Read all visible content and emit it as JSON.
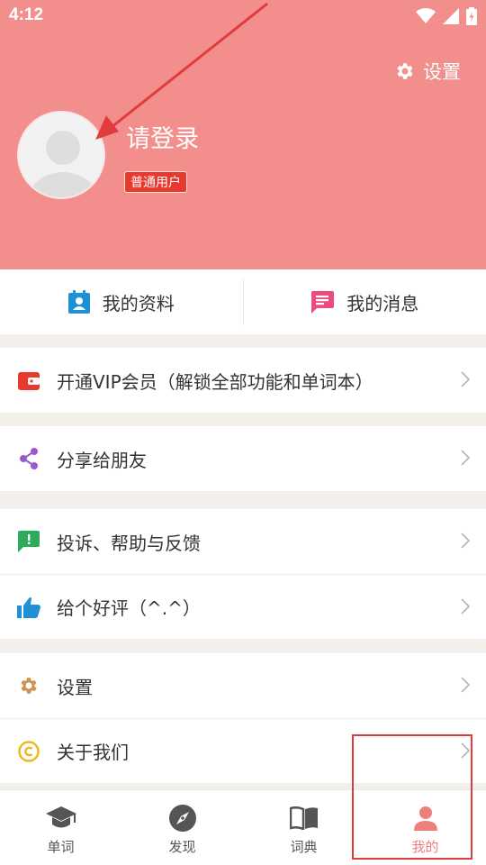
{
  "status": {
    "time": "4:12"
  },
  "header": {
    "settings_label": "设置",
    "login_label": "请登录",
    "user_badge": "普通用户"
  },
  "quick": [
    {
      "label": "我的资料",
      "icon": "profile-card-icon"
    },
    {
      "label": "我的消息",
      "icon": "message-icon"
    }
  ],
  "menu": {
    "vip": "开通VIP会员（解锁全部功能和单词本）",
    "share": "分享给朋友",
    "feedback": "投诉、帮助与反馈",
    "rate": "给个好评（^.^）",
    "settings": "设置",
    "about": "关于我们"
  },
  "tabs": [
    {
      "label": "单词",
      "icon": "graduation-cap-icon"
    },
    {
      "label": "发现",
      "icon": "compass-icon"
    },
    {
      "label": "词典",
      "icon": "book-icon"
    },
    {
      "label": "我的",
      "icon": "person-icon",
      "active": true
    }
  ],
  "colors": {
    "header_bg": "#f28f8d",
    "badge_red": "#e8392e",
    "active_tab": "#ef7f7c",
    "annotation_red": "#e23b3b"
  }
}
